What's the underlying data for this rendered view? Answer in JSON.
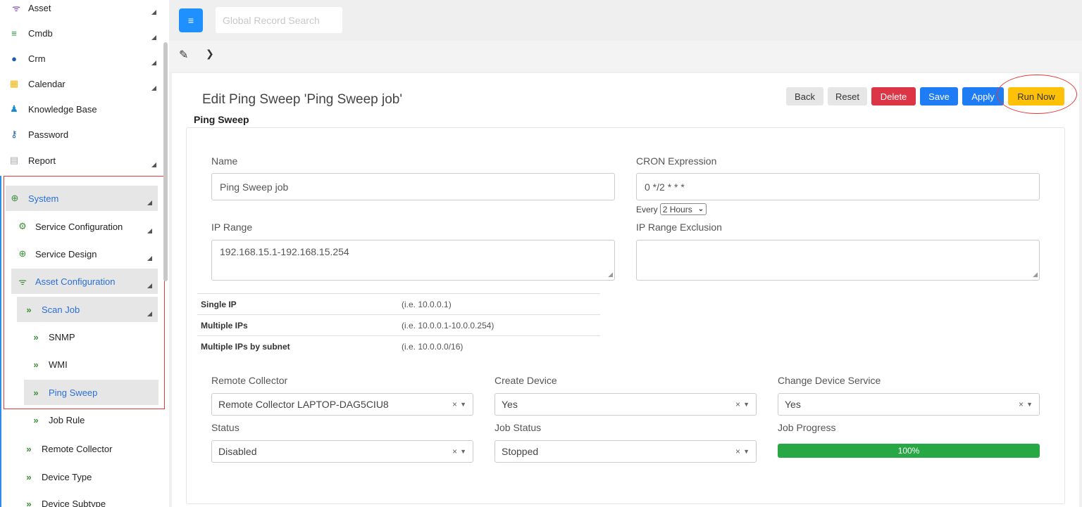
{
  "sidebar": {
    "items": [
      {
        "label": "Asset",
        "icon": "wifi-icon"
      },
      {
        "label": "Cmdb",
        "icon": "database-icon"
      },
      {
        "label": "Crm",
        "icon": "user-icon"
      },
      {
        "label": "Calendar",
        "icon": "calendar-icon"
      },
      {
        "label": "Knowledge Base",
        "icon": "knowledge-icon"
      },
      {
        "label": "Password",
        "icon": "key-icon"
      },
      {
        "label": "Report",
        "icon": "file-icon"
      },
      {
        "label": "System",
        "icon": "globe-icon"
      },
      {
        "label": "Service Configuration",
        "icon": "gears-icon"
      },
      {
        "label": "Service Design",
        "icon": "crosshair-icon"
      },
      {
        "label": "Asset Configuration",
        "icon": "wifi-icon"
      },
      {
        "label": "Scan Job",
        "icon": "double-chevron-icon"
      },
      {
        "label": "SNMP",
        "icon": "double-chevron-icon"
      },
      {
        "label": "WMI",
        "icon": "double-chevron-icon"
      },
      {
        "label": "Ping Sweep",
        "icon": "double-chevron-icon"
      },
      {
        "label": "Job Rule",
        "icon": "double-chevron-icon"
      },
      {
        "label": "Remote Collector",
        "icon": "double-chevron-icon"
      },
      {
        "label": "Device Type",
        "icon": "double-chevron-icon"
      },
      {
        "label": "Device Subtype",
        "icon": "double-chevron-icon"
      }
    ]
  },
  "topbar": {
    "search_placeholder": "Global Record Search"
  },
  "page": {
    "title": "Edit Ping Sweep 'Ping Sweep job'",
    "subtitle": "Ping Sweep"
  },
  "actions": {
    "back": "Back",
    "reset": "Reset",
    "delete": "Delete",
    "save": "Save",
    "apply": "Apply",
    "run_now": "Run Now"
  },
  "form": {
    "name_label": "Name",
    "name_value": "Ping Sweep job",
    "cron_label": "CRON Expression",
    "cron_value": "0 */2 * * *",
    "every_label": "Every",
    "every_value": "2 Hours",
    "ip_range_label": "IP Range",
    "ip_range_value": "192.168.15.1-192.168.15.254",
    "ip_exclusion_label": "IP Range Exclusion",
    "ip_exclusion_value": "",
    "ip_help": [
      {
        "k": "Single IP",
        "v": "(i.e. 10.0.0.1)"
      },
      {
        "k": "Multiple IPs",
        "v": "(i.e. 10.0.0.1-10.0.0.254)"
      },
      {
        "k": "Multiple IPs by subnet",
        "v": "(i.e. 10.0.0.0/16)"
      }
    ],
    "remote_collector_label": "Remote Collector",
    "remote_collector_value": "Remote Collector LAPTOP-DAG5CIU8",
    "create_device_label": "Create Device",
    "create_device_value": "Yes",
    "change_device_service_label": "Change Device Service",
    "change_device_service_value": "Yes",
    "status_label": "Status",
    "status_value": "Disabled",
    "job_status_label": "Job Status",
    "job_status_value": "Stopped",
    "job_progress_label": "Job Progress",
    "job_progress_value": 1.0,
    "job_progress_text": "100%"
  },
  "colors": {
    "primary": "#1e7cf5",
    "danger": "#dc3545",
    "warning": "#ffc107",
    "success": "#28a745"
  }
}
